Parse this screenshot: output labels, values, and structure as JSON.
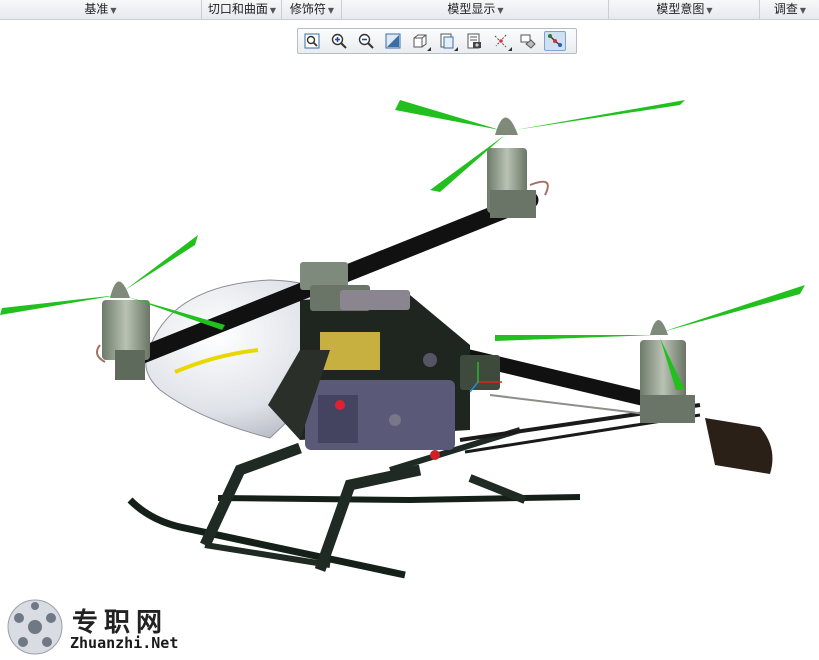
{
  "ribbon": {
    "groups": [
      {
        "label": "基准"
      },
      {
        "label": "切口和曲面"
      },
      {
        "label": "修饰符"
      },
      {
        "label": "模型显示"
      },
      {
        "label": "模型意图"
      },
      {
        "label": "调查"
      }
    ]
  },
  "view_toolbar": {
    "buttons": [
      {
        "icon": "refit-icon"
      },
      {
        "icon": "zoom-in-icon"
      },
      {
        "icon": "zoom-out-icon"
      },
      {
        "icon": "repaint-icon"
      },
      {
        "icon": "display-style-icon"
      },
      {
        "icon": "saved-orientations-icon"
      },
      {
        "icon": "view-manager-icon"
      },
      {
        "icon": "datum-display-filters-icon"
      },
      {
        "icon": "spin-center-icon"
      },
      {
        "icon": "annotation-display-icon",
        "active": true
      }
    ]
  },
  "watermark": {
    "chinese": "专职网",
    "url": "Zhuanzhi.Net"
  },
  "colors": {
    "ribbon_bg": "#eceff3",
    "propeller": "#22c01e",
    "boom": "#111111",
    "canopy": "#e6e8ec",
    "frame": "#1b1f1c",
    "motor": "#8a9a86",
    "battery": "#5a5a78",
    "accent_yellow": "#e8d800"
  }
}
